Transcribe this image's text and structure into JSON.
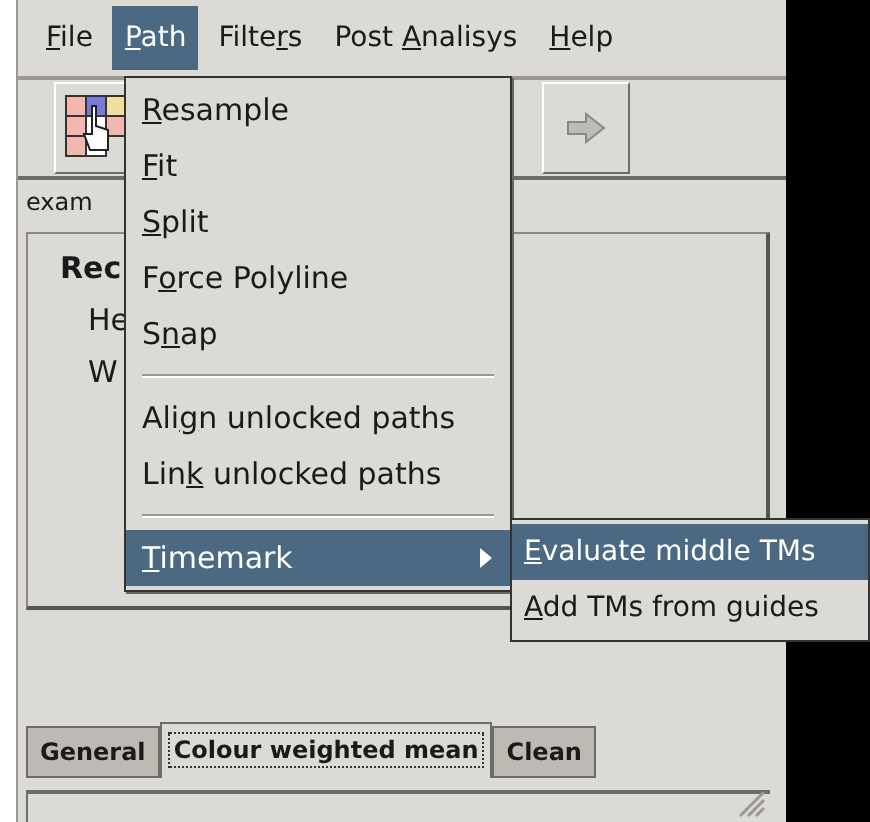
{
  "menubar": [
    {
      "parts": {
        "key": "F",
        "after": "ile"
      },
      "selected": false
    },
    {
      "parts": {
        "key": "P",
        "after": "ath"
      },
      "selected": true
    },
    {
      "parts": {
        "before": "Filte",
        "key": "r",
        "after": "s"
      },
      "selected": false
    },
    {
      "parts": {
        "before": "Post ",
        "key": "A",
        "after": "nalisys"
      },
      "selected": false
    },
    {
      "parts": {
        "key": "H",
        "after": "elp"
      },
      "selected": false
    }
  ],
  "toolbar": [
    {
      "kind": "grid"
    },
    {
      "kind": "arrow"
    }
  ],
  "file_label": "exam",
  "panel": {
    "heading": "Rec",
    "fields": [
      "He",
      "W"
    ]
  },
  "path_menu": [
    {
      "kind": "item",
      "parts": {
        "key": "R",
        "after": "esample"
      },
      "selected": false
    },
    {
      "kind": "item",
      "parts": {
        "key": "F",
        "after": "it"
      },
      "selected": false
    },
    {
      "kind": "item",
      "parts": {
        "key": "S",
        "after": "plit"
      },
      "selected": false
    },
    {
      "kind": "item",
      "parts": {
        "before": "F",
        "key": "o",
        "after": "rce Polyline"
      },
      "selected": false
    },
    {
      "kind": "item",
      "parts": {
        "before": "S",
        "key": "n",
        "after": "ap"
      },
      "selected": false
    },
    {
      "kind": "separator"
    },
    {
      "kind": "item",
      "parts": {
        "before": "Ali",
        "key": "g",
        "after": "n unlocked paths"
      },
      "selected": false
    },
    {
      "kind": "item",
      "parts": {
        "before": "Lin",
        "key": "k",
        "after": " unlocked paths"
      },
      "selected": false
    },
    {
      "kind": "separator"
    },
    {
      "kind": "submenu",
      "parts": {
        "key": "T",
        "after": "imemark"
      },
      "selected": true
    }
  ],
  "submenu": [
    {
      "parts": {
        "key": "E",
        "after": "valuate middle TMs"
      },
      "selected": true
    },
    {
      "parts": {
        "key": "A",
        "after": "dd TMs from guides"
      },
      "selected": false
    }
  ],
  "tabs": [
    {
      "label": "General",
      "selected": false
    },
    {
      "label": "Colour weighted mean",
      "selected": true
    },
    {
      "label": "Clean",
      "selected": false
    }
  ]
}
